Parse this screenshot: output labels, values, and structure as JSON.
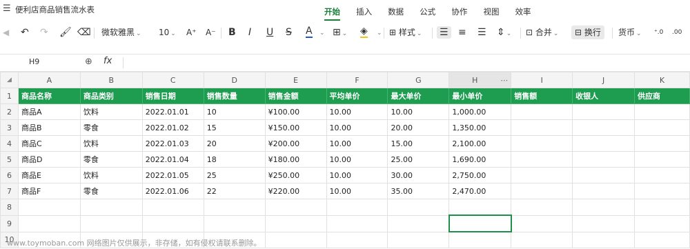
{
  "app": {
    "doc_title": "便利店商品销售流水表",
    "tabs": [
      "开始",
      "插入",
      "数据",
      "公式",
      "协作",
      "视图",
      "效率"
    ],
    "active_tab": "开始"
  },
  "toolbar": {
    "font_name": "微软雅黑",
    "font_size": "10",
    "style_label": "样式",
    "merge_label": "合并",
    "wrap_label": "换行",
    "currency_label": "货币",
    "increase_font": "A⁺",
    "decrease_font": "A⁻",
    "bold": "B",
    "italic": "I",
    "underline": "U",
    "strike": "S",
    "font_color": "A",
    "dec_increase": "⁺.0",
    "dec_decrease": ".00"
  },
  "formula_bar": {
    "name_box": "H9",
    "fx": "fx",
    "formula": ""
  },
  "sheet": {
    "columns": [
      "A",
      "B",
      "C",
      "D",
      "E",
      "F",
      "G",
      "H",
      "I",
      "J",
      "K"
    ],
    "row_numbers": [
      "1",
      "2",
      "3",
      "4",
      "5",
      "6",
      "7",
      "8",
      "9",
      "10"
    ],
    "header": [
      "商品名称",
      "商品类别",
      "销售日期",
      "销售数量",
      "销售金额",
      "平均单价",
      "最大单价",
      "最小单价",
      "销售额",
      "收银人",
      "供应商"
    ],
    "rows": [
      [
        "商品A",
        "饮料",
        "2022.01.01",
        "10",
        "¥100.00",
        "10.00",
        "10.00",
        "1,000.00",
        "",
        "",
        ""
      ],
      [
        "商品B",
        "零食",
        "2022.01.02",
        "15",
        "¥150.00",
        "10.00",
        "20.00",
        "1,350.00",
        "",
        "",
        ""
      ],
      [
        "商品C",
        "饮料",
        "2022.01.03",
        "20",
        "¥200.00",
        "10.00",
        "15.00",
        "2,100.00",
        "",
        "",
        ""
      ],
      [
        "商品D",
        "零食",
        "2022.01.04",
        "18",
        "¥180.00",
        "10.00",
        "25.00",
        "1,690.00",
        "",
        "",
        ""
      ],
      [
        "商品E",
        "饮料",
        "2022.01.05",
        "25",
        "¥250.00",
        "10.00",
        "30.00",
        "2,750.00",
        "",
        "",
        ""
      ],
      [
        "商品F",
        "零食",
        "2022.01.06",
        "22",
        "¥220.00",
        "10.00",
        "35.00",
        "2,470.00",
        "",
        "",
        ""
      ]
    ],
    "selected_cell": "H9",
    "header_color": "#1e9c50"
  },
  "watermark": "www.toymoban.com 网络图片仅供展示，非存储，如有侵权请联系删除。"
}
